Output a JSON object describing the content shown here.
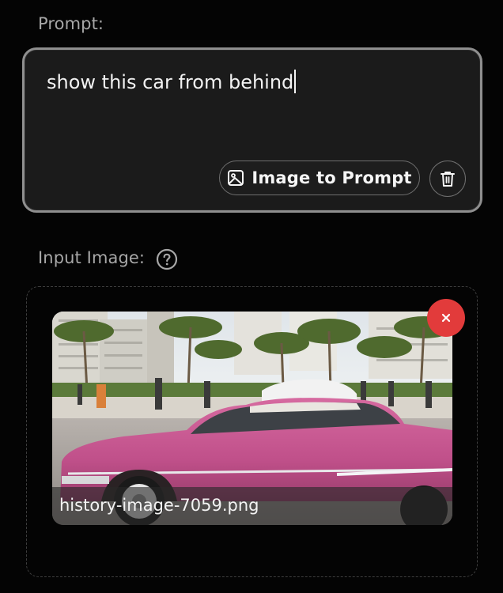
{
  "prompt": {
    "label": "Prompt:",
    "value": "show this car from behind",
    "image_to_prompt_label": "Image to Prompt",
    "image_icon": "image-icon",
    "trash_icon": "trash-icon"
  },
  "input_image": {
    "label": "Input Image:",
    "help_icon": "question-circle-icon",
    "file_name": "history-image-7059.png",
    "remove_icon": "close-icon"
  },
  "colors": {
    "background": "#040404",
    "panel": "#1b1b1b",
    "border": "#8f8f8f",
    "muted_text": "#a7a7a7",
    "remove_red": "#e23b3b",
    "car_pink": "#c8528f"
  }
}
